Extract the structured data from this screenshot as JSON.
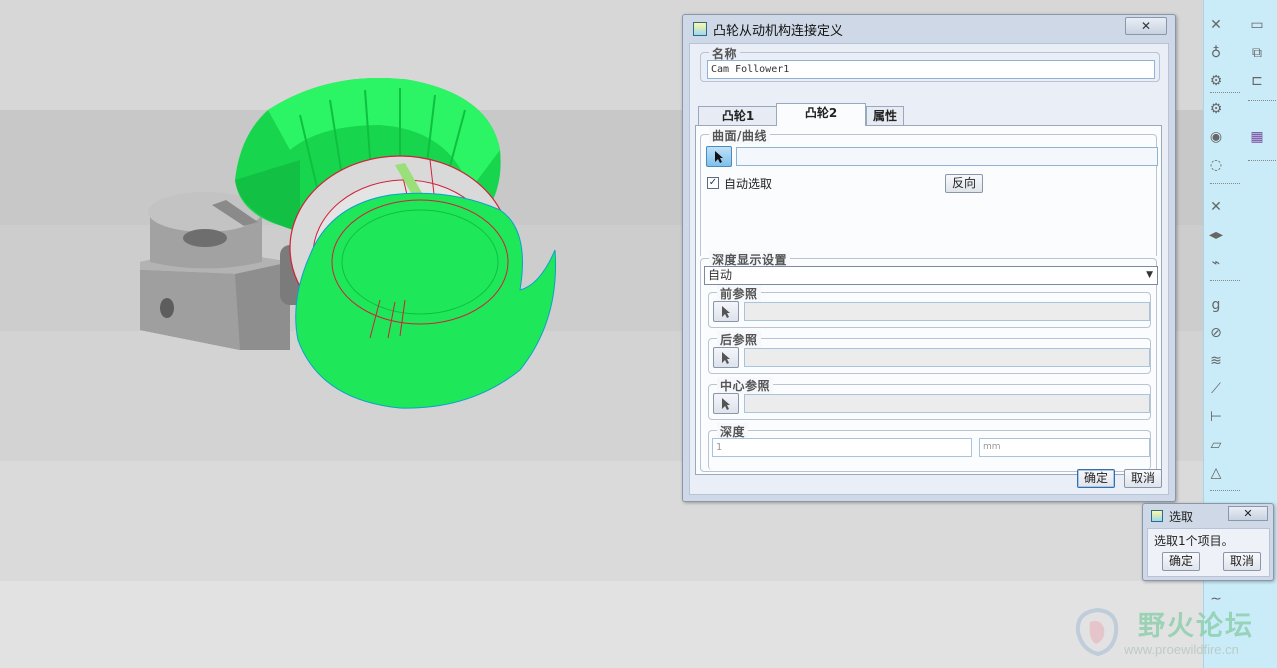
{
  "main_dialog": {
    "title": "凸轮从动机构连接定义",
    "close_glyph": "✕",
    "name_group_label": "名称",
    "name_value": "Cam Follower1",
    "tabs": [
      {
        "label": "凸轮1",
        "active": false
      },
      {
        "label": "凸轮2",
        "active": true
      },
      {
        "label": "属性",
        "active": false
      }
    ],
    "surface_group_label": "曲面/曲线",
    "auto_select_label": "自动选取",
    "auto_select_checked": true,
    "flip_button_label": "反向",
    "depth_display_group_label": "深度显示设置",
    "depth_mode_value": "自动",
    "front_ref_label": "前参照",
    "back_ref_label": "后参照",
    "center_ref_label": "中心参照",
    "depth_group_label": "深度",
    "depth_value": "1",
    "depth_unit": "mm",
    "ok_label": "确定",
    "cancel_label": "取消"
  },
  "select_dialog": {
    "title": "选取",
    "close_glyph": "✕",
    "message": "选取1个项目。",
    "ok_label": "确定",
    "cancel_label": "取消"
  },
  "watermark": {
    "text": "野火论坛",
    "url": "www.proewildfire.cn"
  },
  "toolbar": {
    "icons": [
      "servo-motor-icon",
      "gravity-icon",
      "gears-icon",
      "gear-pair-icon",
      "cam-icon",
      "slot-icon",
      "connection-icon",
      "drag-icon",
      "graph-icon",
      "spring-icon",
      "damper-icon",
      "force-icon",
      "torque-icon",
      "mass-property-icon",
      "analysis-icon",
      "dialog-icon",
      "snapshot-icon",
      "layout-icon",
      "grid-icon",
      "curve-icon",
      "measure-icon"
    ]
  },
  "colors": {
    "dialog_frame": "#cfd8e6",
    "toolbar_bg": "#c9ecf8",
    "model_green": "#1ee85a",
    "model_gray": "#9a9a9a",
    "selection_red": "#d0203a"
  }
}
